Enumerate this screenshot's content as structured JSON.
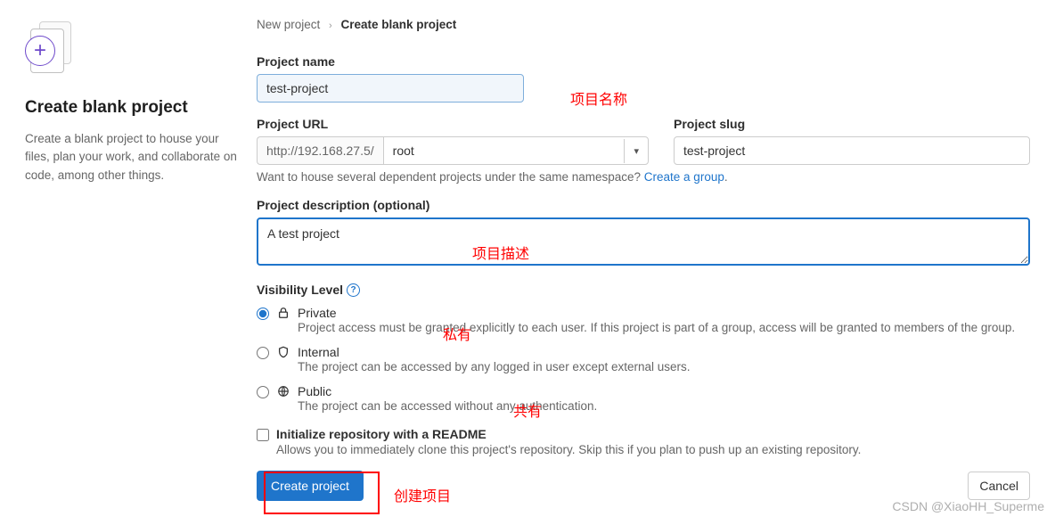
{
  "breadcrumb": {
    "parent": "New project",
    "current": "Create blank project"
  },
  "left": {
    "title": "Create blank project",
    "desc": "Create a blank project to house your files, plan your work, and collaborate on code, among other things."
  },
  "form": {
    "name_label": "Project name",
    "name_value": "test-project",
    "url_label": "Project URL",
    "url_prefix": "http://192.168.27.5/",
    "url_namespace": "root",
    "slug_label": "Project slug",
    "slug_value": "test-project",
    "namespace_hint": "Want to house several dependent projects under the same namespace? ",
    "namespace_link": "Create a group",
    "desc_label": "Project description (optional)",
    "desc_value": "A test project",
    "visibility_label": "Visibility Level",
    "visibility": [
      {
        "id": "private",
        "title": "Private",
        "desc": "Project access must be granted explicitly to each user. If this project is part of a group, access will be granted to members of the group."
      },
      {
        "id": "internal",
        "title": "Internal",
        "desc": "The project can be accessed by any logged in user except external users."
      },
      {
        "id": "public",
        "title": "Public",
        "desc": "The project can be accessed without any authentication."
      }
    ],
    "init_readme_label": "Initialize repository with a README",
    "init_readme_desc": "Allows you to immediately clone this project's repository. Skip this if you plan to push up an existing repository.",
    "create_label": "Create project",
    "cancel_label": "Cancel"
  },
  "annotations": {
    "name": "项目名称",
    "desc": "项目描述",
    "private": "私有",
    "public": "共有",
    "create": "创建项目"
  },
  "watermark": "CSDN @XiaoHH_Superme"
}
